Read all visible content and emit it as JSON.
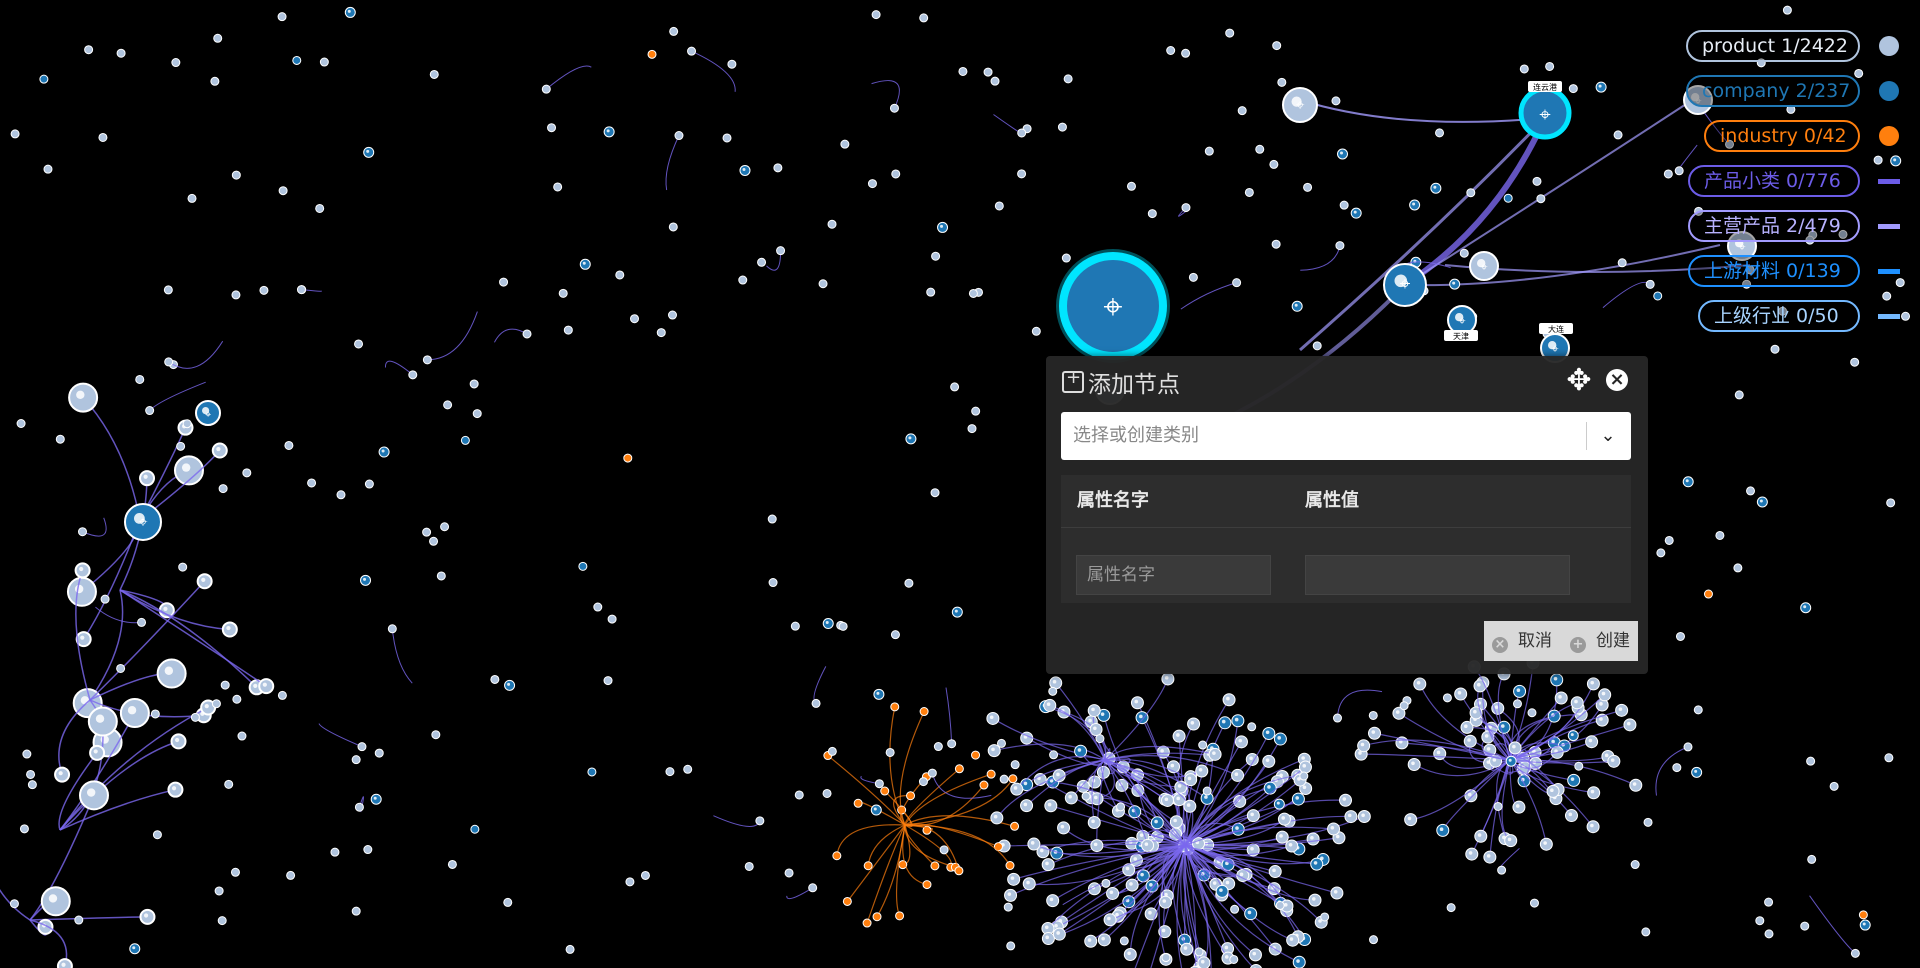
{
  "legend": {
    "items": [
      {
        "label": "product 1/2422",
        "color": "#b0c4de",
        "kind": "dot"
      },
      {
        "label": "company  2/237",
        "color": "#1f77b4",
        "kind": "dot"
      },
      {
        "label": "industry 0/42",
        "color": "#ff7f0e",
        "kind": "dot"
      },
      {
        "label": "产品小类 0/776",
        "color": "#6c5ce7",
        "kind": "bar"
      },
      {
        "label": "主营产品 2/479",
        "color": "#a29bfe",
        "kind": "bar"
      },
      {
        "label": "上游材料 0/139",
        "color": "#1e90ff",
        "kind": "bar"
      },
      {
        "label": "上级行业 0/50",
        "color": "#74b9ff",
        "kind": "bar"
      }
    ]
  },
  "dialog": {
    "title": "添加节点",
    "move_icon": "move-icon",
    "close_icon": "close-icon",
    "category_select": {
      "placeholder": "选择或创建类别"
    },
    "table": {
      "headers": [
        "属性名字",
        "属性值"
      ],
      "row": {
        "name_placeholder": "属性名字",
        "value": ""
      }
    },
    "cancel_label": "取消",
    "create_label": "创建"
  },
  "graph": {
    "colors": {
      "product": "#b0c4de",
      "company": "#1f77b4",
      "industry": "#ff7f0e",
      "link": "#7b68ee",
      "highlight": "#00e5ff"
    },
    "node_labels": [
      "连云港",
      "大连",
      "天津"
    ]
  }
}
